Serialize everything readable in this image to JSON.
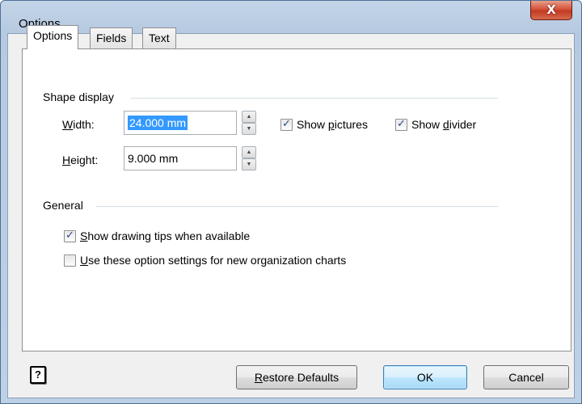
{
  "window": {
    "title": "Options",
    "close_glyph": "X"
  },
  "tabs": [
    {
      "label": "Options",
      "active": true
    },
    {
      "label": "Fields",
      "active": false
    },
    {
      "label": "Text",
      "active": false
    }
  ],
  "shape_display": {
    "group_label": "Shape display",
    "width_label_u": "W",
    "width_label_rest": "idth:",
    "width_value": "24.000 mm",
    "height_label_u": "H",
    "height_label_rest": "eight:",
    "height_value": "9.000 mm",
    "show_pictures": {
      "pre": "Show ",
      "u": "p",
      "post": "ictures",
      "checked": true
    },
    "show_divider": {
      "pre": "Show ",
      "u": "d",
      "post": "ivider",
      "checked": true
    }
  },
  "general": {
    "group_label": "General",
    "drawing_tips": {
      "u": "S",
      "post": "how drawing tips when available",
      "checked": true
    },
    "use_settings": {
      "u": "U",
      "post": "se these option settings for new organization charts",
      "checked": false
    }
  },
  "buttons": {
    "help": "?",
    "restore_u": "R",
    "restore_rest": "estore Defaults",
    "ok": "OK",
    "cancel": "Cancel"
  },
  "icons": {
    "spin_up": "▲",
    "spin_down": "▼",
    "check": "✓"
  },
  "colors": {
    "title_bar": "#b5c9e0",
    "close_button": "#c23a22",
    "selection": "#3399ff",
    "default_button": "#3c7fb1"
  }
}
